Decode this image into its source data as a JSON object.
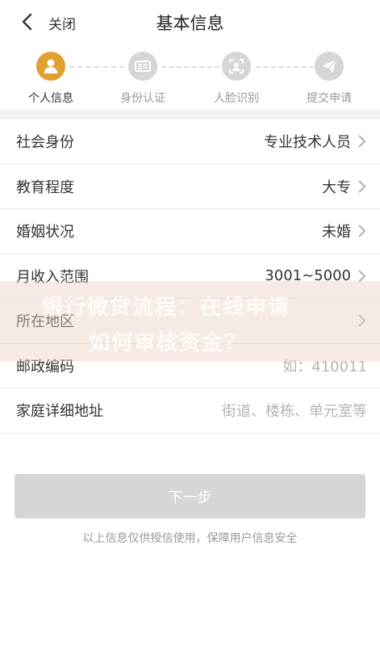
{
  "nav": {
    "back_icon": "chevron-left-icon",
    "close_label": "关闭",
    "title": "基本信息"
  },
  "steps": [
    {
      "label": "个人信息",
      "icon": "person-icon",
      "active": true
    },
    {
      "label": "身份认证",
      "icon": "id-card-icon",
      "active": false
    },
    {
      "label": "人脸识别",
      "icon": "face-icon",
      "active": false
    },
    {
      "label": "提交申请",
      "icon": "paper-plane-icon",
      "active": false
    }
  ],
  "form": {
    "rows": [
      {
        "label": "社会身份",
        "value": "专业技术人员",
        "chevron": true
      },
      {
        "label": "教育程度",
        "value": "大专",
        "chevron": true
      },
      {
        "label": "婚姻状况",
        "value": "未婚",
        "chevron": true
      },
      {
        "label": "月收入范围",
        "value": "3001~5000",
        "chevron": true
      },
      {
        "label": "所在地区",
        "value": "",
        "chevron": true
      },
      {
        "label": "邮政编码",
        "placeholder": "如：410011"
      },
      {
        "label": "家庭详细地址",
        "placeholder": "街道、楼栋、单元室等"
      }
    ]
  },
  "next_button": "下一步",
  "footer_note": "以上信息仅供授信使用，保障用户信息安全",
  "watermark": {
    "line1": "银行微贷流程：在线申请",
    "line2": "如何审核资金？"
  },
  "colors": {
    "accent": "#e0a032",
    "inactive": "#d6d6d6",
    "placeholder": "#b5b5b5"
  }
}
